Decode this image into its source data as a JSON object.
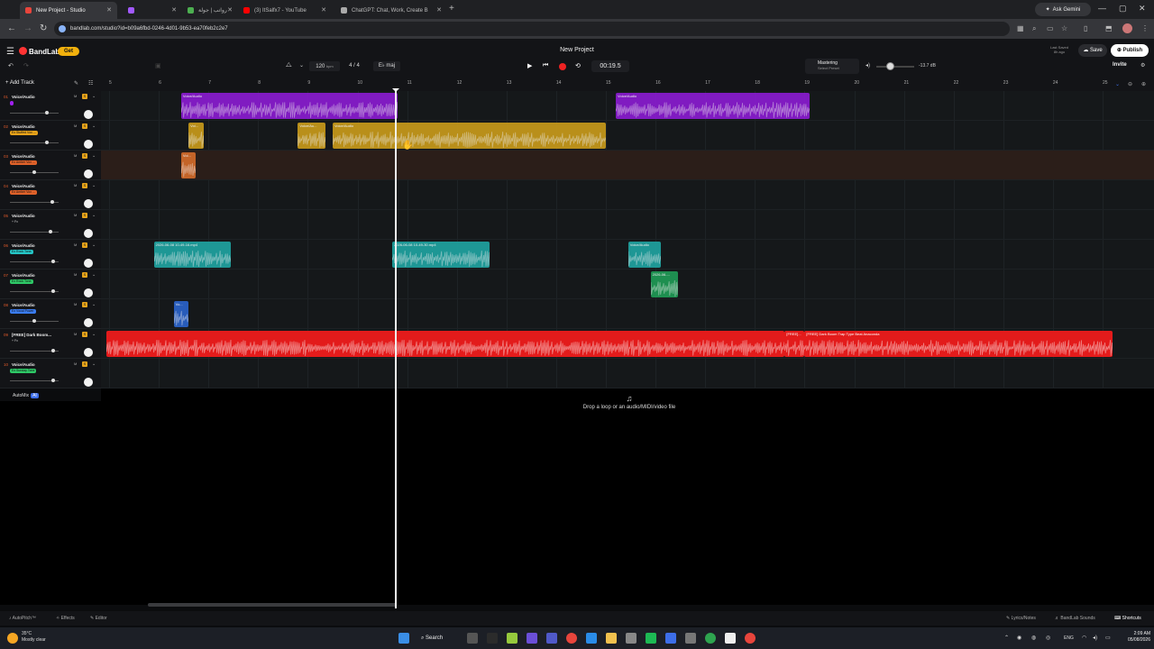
{
  "browser": {
    "tabs": [
      {
        "title": "New Project - Studio",
        "active": true,
        "color": "#e8453c"
      },
      {
        "title": "",
        "active": false,
        "color": "#a259ff"
      },
      {
        "title": "رواتب | جولة",
        "active": false,
        "color": "#4caf50"
      },
      {
        "title": "(3) ItSalfx7 - YouTube",
        "active": false,
        "color": "#ff0000"
      },
      {
        "title": "ChatGPT: Chat, Work, Create B",
        "active": false,
        "color": "#aaaaaa"
      }
    ],
    "new_tab": "+",
    "ask_gemini": "Ask Gemini",
    "url": "bandlab.com/studio?id=b09a6fbd-0246-4d01-9b53-ea70feb2c2e7"
  },
  "studio": {
    "brand": "BandLab",
    "get_plus": "Get",
    "project_title": "New Project",
    "last_saved_label": "Last Saved",
    "last_saved_value": "8h ago",
    "save_label": "Save",
    "publish_label": "Publish",
    "invite_label": "Invite",
    "tempo": "120",
    "tempo_unit": "bpm",
    "time_signature": "4 / 4",
    "key": "E♭ maj",
    "time_display": "00:19.5",
    "mastering_title": "Mastering",
    "mastering_sub": "Select Preset",
    "master_db": "-13.7 dB",
    "add_track": "Add Track",
    "ruler_start": 5,
    "ruler_end": 25,
    "playhead_bar": 10.75,
    "drop_hint": "Drop a loop or an audio/MIDI/video file",
    "automix_label": "AutoMix",
    "automix_badge": "AI"
  },
  "tracks": [
    {
      "id": "01",
      "name": "Voice/Audio",
      "fx": "",
      "fx_color": "#a020f0",
      "color": "#8a1cd0",
      "volume": 0.78
    },
    {
      "id": "02",
      "name": "Voice/Audio",
      "fx": "Ex Stuffed Vox ...",
      "fx_color": "#e6a21a",
      "color": "#c79a1b",
      "volume": 0.78
    },
    {
      "id": "03",
      "name": "Voice/Audio",
      "fx": "Ex Amber Vox ...",
      "fx_color": "#e0622a",
      "color": "#d26a2a",
      "volume": 0.5
    },
    {
      "id": "04",
      "name": "Voice/Audio",
      "fx": "Ex Amber Vox ...",
      "fx_color": "#e0622a",
      "color": "#d26a2a",
      "volume": 0.9
    },
    {
      "id": "05",
      "name": "Voice/Audio",
      "fx": "+ Fx",
      "fx_color": "",
      "color": "#888888",
      "volume": 0.85
    },
    {
      "id": "06",
      "name": "Voice/Audio",
      "fx": "Ex Rock Tone",
      "fx_color": "#25c5c5",
      "color": "#1fa2a0",
      "volume": 0.92
    },
    {
      "id": "07",
      "name": "Voice/Audio",
      "fx": "Ex Rock Tone",
      "fx_color": "#2ec866",
      "color": "#1f9a55",
      "volume": 0.92
    },
    {
      "id": "08",
      "name": "Voice/Audio",
      "fx": "Ex Vocal Power",
      "fx_color": "#3a7cf0",
      "color": "#2a62c8",
      "volume": 0.5
    },
    {
      "id": "09",
      "name": "[FREE] Dark Boom...",
      "fx": "+ Fx",
      "fx_color": "",
      "color": "#e31b1b",
      "volume": 0.92
    },
    {
      "id": "10",
      "name": "Voice/Audio",
      "fx": "Ex Sunday Tone",
      "fx_color": "#2ec866",
      "color": "#1f9a55",
      "volume": 0.92
    }
  ],
  "clips": [
    {
      "track": 0,
      "start": 6.45,
      "end": 10.8,
      "color": "#8a1cd0",
      "label": "Voice/Audio"
    },
    {
      "track": 0,
      "start": 15.2,
      "end": 19.1,
      "color": "#8a1cd0",
      "label": "Voice/Audio"
    },
    {
      "track": 1,
      "start": 6.6,
      "end": 6.9,
      "color": "#c79a1b",
      "label": "Voi..."
    },
    {
      "track": 1,
      "start": 8.8,
      "end": 9.35,
      "color": "#c79a1b",
      "label": "Voice/Au..."
    },
    {
      "track": 1,
      "start": 9.5,
      "end": 15.0,
      "color": "#c79a1b",
      "label": "Voice/Audio"
    },
    {
      "track": 2,
      "start": 6.45,
      "end": 6.75,
      "color": "#d26a2a",
      "label": "Voi..."
    },
    {
      "track": 5,
      "start": 5.9,
      "end": 7.45,
      "color": "#1fa2a0",
      "label": "2026-06-08 10-49-16.mp4"
    },
    {
      "track": 5,
      "start": 10.7,
      "end": 12.65,
      "color": "#1fa2a0",
      "label": "2026-06-08 10-49-30.mp4"
    },
    {
      "track": 5,
      "start": 15.45,
      "end": 16.1,
      "color": "#1fa2a0",
      "label": "Voice/Audio"
    },
    {
      "track": 6,
      "start": 15.9,
      "end": 16.45,
      "color": "#1f9a55",
      "label": "2026-06-..."
    },
    {
      "track": 7,
      "start": 6.3,
      "end": 6.6,
      "color": "#2a62c8",
      "label": "Vo..."
    },
    {
      "track": 8,
      "start": 4.95,
      "end": 18.6,
      "color": "#e31b1b",
      "label": ""
    },
    {
      "track": 8,
      "start": 18.6,
      "end": 19.0,
      "color": "#e31b1b",
      "label": "[FREE]..."
    },
    {
      "track": 8,
      "start": 19.0,
      "end": 25.2,
      "color": "#e31b1b",
      "label": "[FREE] Dark Boom Trap Type Beat Anaconda"
    }
  ],
  "bottom_bar": {
    "autopitch": "AutoPitch™",
    "effects": "Effects",
    "editor": "Editor",
    "lyrics": "Lyrics/Notes",
    "sounds": "BandLab Sounds",
    "shortcuts": "Shortcuts"
  },
  "taskbar": {
    "temp": "35°C",
    "weather": "Mostly clear",
    "search": "Search",
    "lang": "ENG",
    "time": "2:09 AM",
    "date": "05/08/2026"
  }
}
